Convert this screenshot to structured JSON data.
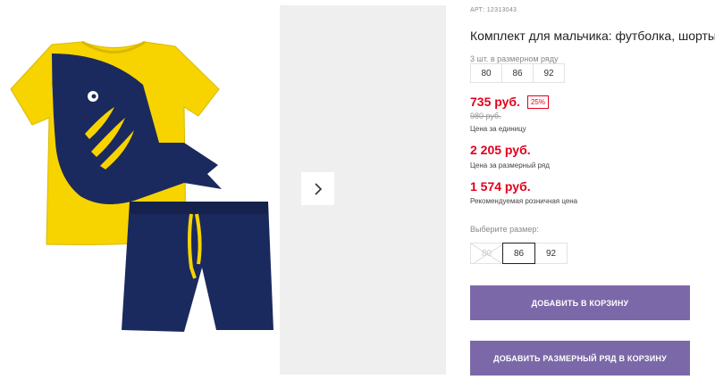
{
  "product": {
    "article": "АРТ: 12313043",
    "title": "Комплект для мальчика: футболка, шорты"
  },
  "pack": {
    "label": "3 шт. в размерном ряду",
    "sizes": [
      "80",
      "86",
      "92"
    ]
  },
  "prices": {
    "unit_price": "735 руб.",
    "discount": "25%",
    "old_price": "980 руб.",
    "unit_caption": "Цена за единицу",
    "pack_price": "2 205 руб.",
    "pack_caption": "Цена за размерный ряд",
    "retail_price": "1 574 руб.",
    "retail_caption": "Рекомендуемая розничная цена"
  },
  "size_select": {
    "label": "Выберите размер:",
    "options": [
      {
        "label": "80",
        "state": "disabled"
      },
      {
        "label": "86",
        "state": "selected"
      },
      {
        "label": "92",
        "state": "available"
      }
    ]
  },
  "actions": {
    "add_to_cart": "ДОБАВИТЬ В КОРЗИНУ",
    "add_pack_to_cart": "ДОБАВИТЬ РАЗМЕРНЫЙ РЯД В КОРЗИНУ"
  },
  "colors": {
    "accent": "#e3001b",
    "button": "#7b68a8",
    "shirt": "#f7d400",
    "navy": "#1b2a5e"
  },
  "icons": {
    "next": "chevron-right-icon"
  }
}
